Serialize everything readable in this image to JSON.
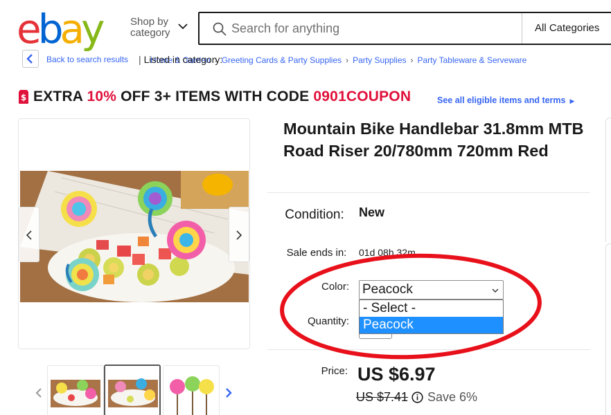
{
  "header": {
    "logo_letters": [
      "e",
      "b",
      "a",
      "y"
    ],
    "logo_colors": [
      "#e53238",
      "#0064d2",
      "#f5af02",
      "#86b817"
    ],
    "shop_by_line1": "Shop by",
    "shop_by_line2": "category",
    "search_placeholder": "Search for anything",
    "category_select": "All Categories"
  },
  "breadcrumb": {
    "back_label": "Back to search results",
    "listed_label": "Listed in category:",
    "items": [
      "Home & Garden",
      "Greeting Cards & Party Supplies",
      "Party Supplies",
      "Party Tableware & Serveware"
    ]
  },
  "promo": {
    "part1": "EXTRA ",
    "percent": "10%",
    "part2": " OFF 3+ ITEMS WITH CODE ",
    "code": "0901COUPON",
    "terms_link": "See all eligible items and terms",
    "accent_color": "#e0103a"
  },
  "product": {
    "title": "Mountain Bike Handlebar 31.8mm MTB Road Riser 20/780mm 720mm Red",
    "condition_label": "Condition:",
    "condition_value": "New",
    "sale_ends_label": "Sale ends in:",
    "sale_ends_value": "01d 08h 32m",
    "color_label": "Color:",
    "color_selected": "Peacock",
    "color_options": [
      "- Select -",
      "Peacock"
    ],
    "quantity_label": "Quantity:",
    "price_label": "Price:",
    "price": "US $6.97",
    "was_price": "US $7.41",
    "save_text": "Save 6%"
  },
  "gallery": {
    "thumbnail_count": 3,
    "selected_thumbnail": 2
  },
  "colors": {
    "link": "#3665f3",
    "highlight": "#1e90ff",
    "annotation": "#e8101a"
  }
}
